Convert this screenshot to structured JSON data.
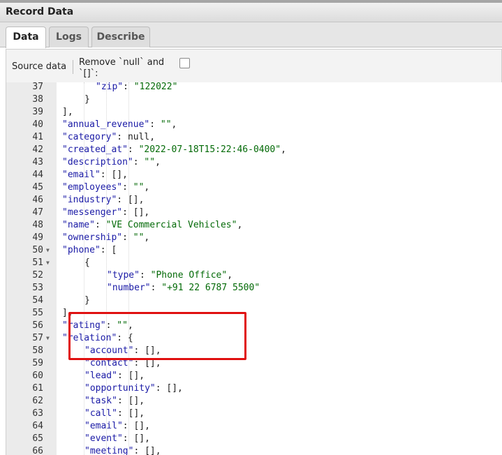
{
  "window": {
    "title": "Record Data"
  },
  "tabs": [
    {
      "label": "Data",
      "active": true
    },
    {
      "label": "Logs",
      "active": false
    },
    {
      "label": "Describe",
      "active": false
    }
  ],
  "toolbar": {
    "source_label": "Source data",
    "remove_label": "Remove `null` and `[]`:",
    "remove_checked": false
  },
  "editor": {
    "lines": [
      {
        "n": "37",
        "indent": 5,
        "tokens": [
          [
            "k",
            "\"zip\""
          ],
          [
            "p",
            ": "
          ],
          [
            "s",
            "\"122022\""
          ]
        ]
      },
      {
        "n": "38",
        "indent": 4,
        "tokens": [
          [
            "p",
            "}"
          ]
        ]
      },
      {
        "n": "39",
        "indent": 2,
        "tokens": [
          [
            "p",
            "],"
          ]
        ]
      },
      {
        "n": "40",
        "indent": 2,
        "tokens": [
          [
            "k",
            "\"annual_revenue\""
          ],
          [
            "p",
            ": "
          ],
          [
            "s",
            "\"\""
          ],
          [
            "p",
            ","
          ]
        ]
      },
      {
        "n": "41",
        "indent": 2,
        "tokens": [
          [
            "k",
            "\"category\""
          ],
          [
            "p",
            ": "
          ],
          [
            "n",
            "null"
          ],
          [
            "p",
            ","
          ]
        ]
      },
      {
        "n": "42",
        "indent": 2,
        "tokens": [
          [
            "k",
            "\"created_at\""
          ],
          [
            "p",
            ": "
          ],
          [
            "s",
            "\"2022-07-18T15:22:46-0400\""
          ],
          [
            "p",
            ","
          ]
        ]
      },
      {
        "n": "43",
        "indent": 2,
        "tokens": [
          [
            "k",
            "\"description\""
          ],
          [
            "p",
            ": "
          ],
          [
            "s",
            "\"\""
          ],
          [
            "p",
            ","
          ]
        ]
      },
      {
        "n": "44",
        "indent": 2,
        "tokens": [
          [
            "k",
            "\"email\""
          ],
          [
            "p",
            ": [],"
          ]
        ]
      },
      {
        "n": "45",
        "indent": 2,
        "tokens": [
          [
            "k",
            "\"employees\""
          ],
          [
            "p",
            ": "
          ],
          [
            "s",
            "\"\""
          ],
          [
            "p",
            ","
          ]
        ]
      },
      {
        "n": "46",
        "indent": 2,
        "tokens": [
          [
            "k",
            "\"industry\""
          ],
          [
            "p",
            ": [],"
          ]
        ]
      },
      {
        "n": "47",
        "indent": 2,
        "tokens": [
          [
            "k",
            "\"messenger\""
          ],
          [
            "p",
            ": [],"
          ]
        ]
      },
      {
        "n": "48",
        "indent": 2,
        "tokens": [
          [
            "k",
            "\"name\""
          ],
          [
            "p",
            ": "
          ],
          [
            "s",
            "\"VE Commercial Vehicles\""
          ],
          [
            "p",
            ","
          ]
        ]
      },
      {
        "n": "49",
        "indent": 2,
        "tokens": [
          [
            "k",
            "\"ownership\""
          ],
          [
            "p",
            ": "
          ],
          [
            "s",
            "\"\""
          ],
          [
            "p",
            ","
          ]
        ]
      },
      {
        "n": "50",
        "indent": 2,
        "fold": true,
        "tokens": [
          [
            "k",
            "\"phone\""
          ],
          [
            "p",
            ": ["
          ]
        ]
      },
      {
        "n": "51",
        "indent": 4,
        "fold": true,
        "tokens": [
          [
            "p",
            "{"
          ]
        ]
      },
      {
        "n": "52",
        "indent": 6,
        "tokens": [
          [
            "k",
            "\"type\""
          ],
          [
            "p",
            ": "
          ],
          [
            "s",
            "\"Phone Office\""
          ],
          [
            "p",
            ","
          ]
        ]
      },
      {
        "n": "53",
        "indent": 6,
        "tokens": [
          [
            "k",
            "\"number\""
          ],
          [
            "p",
            ": "
          ],
          [
            "s",
            "\"+91 22 6787 5500\""
          ]
        ]
      },
      {
        "n": "54",
        "indent": 4,
        "tokens": [
          [
            "p",
            "}"
          ]
        ]
      },
      {
        "n": "55",
        "indent": 2,
        "tokens": [
          [
            "p",
            "],"
          ]
        ]
      },
      {
        "n": "56",
        "indent": 2,
        "tokens": [
          [
            "k",
            "\"rating\""
          ],
          [
            "p",
            ": "
          ],
          [
            "s",
            "\"\""
          ],
          [
            "p",
            ","
          ]
        ]
      },
      {
        "n": "57",
        "indent": 2,
        "fold": true,
        "tokens": [
          [
            "k",
            "\"relation\""
          ],
          [
            "p",
            ": {"
          ]
        ]
      },
      {
        "n": "58",
        "indent": 4,
        "tokens": [
          [
            "k",
            "\"account\""
          ],
          [
            "p",
            ": [],"
          ]
        ]
      },
      {
        "n": "59",
        "indent": 4,
        "tokens": [
          [
            "k",
            "\"contact\""
          ],
          [
            "p",
            ": [],"
          ]
        ]
      },
      {
        "n": "60",
        "indent": 4,
        "tokens": [
          [
            "k",
            "\"lead\""
          ],
          [
            "p",
            ": [],"
          ]
        ]
      },
      {
        "n": "61",
        "indent": 4,
        "tokens": [
          [
            "k",
            "\"opportunity\""
          ],
          [
            "p",
            ": [],"
          ]
        ]
      },
      {
        "n": "62",
        "indent": 4,
        "tokens": [
          [
            "k",
            "\"task\""
          ],
          [
            "p",
            ": [],"
          ]
        ]
      },
      {
        "n": "63",
        "indent": 4,
        "tokens": [
          [
            "k",
            "\"call\""
          ],
          [
            "p",
            ": [],"
          ]
        ]
      },
      {
        "n": "64",
        "indent": 4,
        "tokens": [
          [
            "k",
            "\"email\""
          ],
          [
            "p",
            ": [],"
          ]
        ]
      },
      {
        "n": "65",
        "indent": 4,
        "tokens": [
          [
            "k",
            "\"event\""
          ],
          [
            "p",
            ": [],"
          ]
        ]
      },
      {
        "n": "66",
        "indent": 4,
        "tokens": [
          [
            "k",
            "\"meeting\""
          ],
          [
            "p",
            ": [],"
          ]
        ]
      }
    ]
  },
  "colors": {
    "highlight": "#e01010",
    "key": "#1a1aa6",
    "string": "#036a07"
  }
}
